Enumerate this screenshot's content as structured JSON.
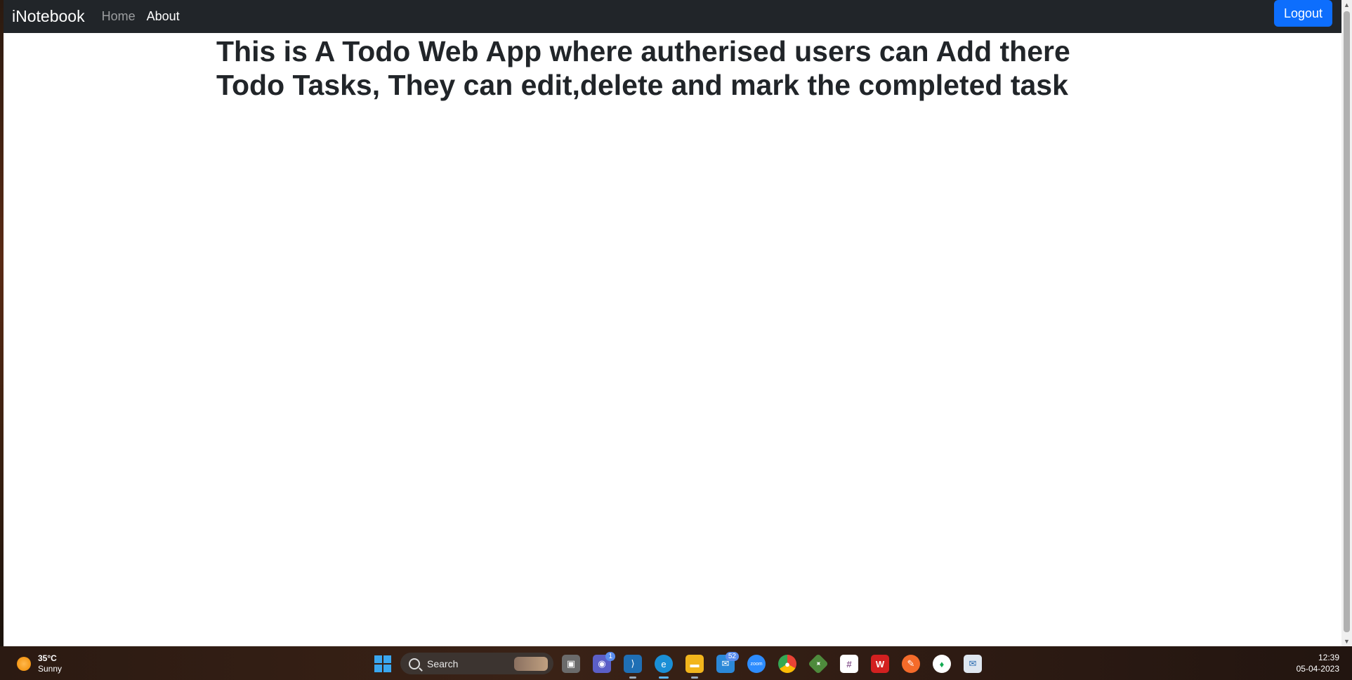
{
  "navbar": {
    "brand": "iNotebook",
    "links": [
      {
        "label": "Home",
        "active": false
      },
      {
        "label": "About",
        "active": true
      }
    ],
    "logout_label": "Logout"
  },
  "about": {
    "text": "This is A Todo Web App where autherised users can Add there Todo Tasks, They can edit,delete and mark the completed task"
  },
  "taskbar": {
    "weather": {
      "temp": "35°C",
      "condition": "Sunny"
    },
    "search_label": "Search",
    "badges": {
      "teams": "1",
      "mail": "52"
    },
    "zoom_label": "zoom",
    "clock": {
      "time": "12:39",
      "date": "05-04-2023"
    }
  },
  "colors": {
    "navbar": "#212529",
    "logout": "#0d6efd"
  }
}
